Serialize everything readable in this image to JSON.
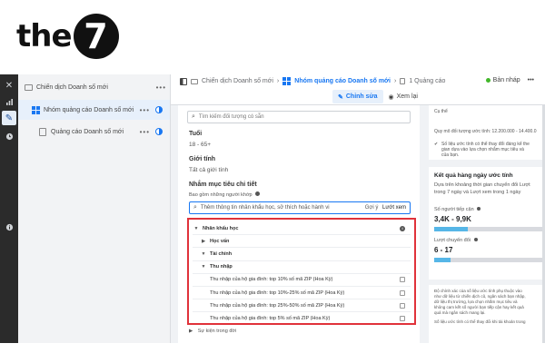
{
  "logo": {
    "text": "the",
    "circle": "7"
  },
  "rail": {
    "icons": [
      "close-icon",
      "chart-icon",
      "pencil-icon",
      "clock-icon",
      "info-icon"
    ]
  },
  "tree": {
    "campaign": "Chiến dịch Doanh số mới",
    "adset": "Nhóm quảng cáo Doanh số mới",
    "ad": "Quảng cáo Doanh số mới",
    "more": "•••"
  },
  "topbar": {
    "crumb1": "Chiến dịch Doanh số mới",
    "crumb2": "Nhóm quảng cáo Doanh số mới",
    "crumb3": "1 Quảng cáo",
    "status": "Bản nháp",
    "tab_edit": "Chỉnh sửa",
    "tab_view": "Xem lại"
  },
  "form": {
    "search_placeholder": "Tìm kiếm đối tượng có sẵn",
    "age_label": "Tuổi",
    "age_value": "18 - 65+",
    "gender_label": "Giới tính",
    "gender_value": "Tất cả giới tính",
    "detail_label": "Nhắm mục tiêu chi tiết",
    "detail_sub": "Bao gồm những người khớp",
    "detail_placeholder": "Thêm thông tin nhân khẩu học, sở thích hoặc hành vi",
    "suggest": "Gợi ý",
    "browse": "Lướt xem",
    "after": "Sự kiện trong đời"
  },
  "results": [
    {
      "label": "Nhân khẩu học",
      "level": 0,
      "caret": "▼",
      "type": "cat-info"
    },
    {
      "label": "Học vấn",
      "level": 1,
      "caret": "▶",
      "type": "cat"
    },
    {
      "label": "Tài chính",
      "level": 1,
      "caret": "▼",
      "type": "cat"
    },
    {
      "label": "Thu nhập",
      "level": 2,
      "caret": "▼",
      "type": "cat"
    },
    {
      "label": "Thu nhập của hộ gia đình: top 10% số mã ZIP (Hoa Kỳ)",
      "level": 3,
      "caret": "",
      "type": "item"
    },
    {
      "label": "Thu nhập của hộ gia đình: top 10%-25% số mã ZIP (Hoa Kỳ)",
      "level": 3,
      "caret": "",
      "type": "item"
    },
    {
      "label": "Thu nhập của hộ gia đình: top 25%-50% số mã ZIP (Hoa Kỳ)",
      "level": 3,
      "caret": "",
      "type": "item"
    },
    {
      "label": "Thu nhập của hộ gia đình: top 5% số mã ZIP (Hoa Kỳ)",
      "level": 3,
      "caret": "",
      "type": "item"
    }
  ],
  "right": {
    "line1": "Cụ thể",
    "size": "Quy mô đối tượng ước tính: 12.200.000 - 14.400.0",
    "note1": "Số liệu ước tính có thể thay đổi đáng kể the",
    "note2": "gian dựa vào lựa chọn nhắm mục tiêu và",
    "note3": "của bạn.",
    "results_title": "Kết quả hàng ngày ước tính",
    "results_sub1": "Dựa trên khoảng thời gian chuyển đổi Lượt",
    "results_sub2": "trong 7 ngày và Lượt xem trong 1 ngày",
    "reach_label": "Số người tiếp cận",
    "reach_value": "3,4K - 9,9K",
    "reach_fill": 0.3,
    "conv_label": "Lượt chuyển đổi",
    "conv_value": "6 - 17",
    "conv_fill": 0.15,
    "foot1": "Độ chính xác của số liệu ước tính phụ thuộc vào",
    "foot2": "như dữ liệu từ chiến dịch cũ, ngân sách bạn nhập,",
    "foot3": "dữ liệu thị trường, lựa chọn nhắm mục tiêu và",
    "foot4": "không cam kết số người bạn tiếp cận hay kết quả",
    "foot5": "quá mà ngân sách mang lại.",
    "foot6": "Số liệu ước tính có thể thay đổi khi tài khoản trong"
  }
}
